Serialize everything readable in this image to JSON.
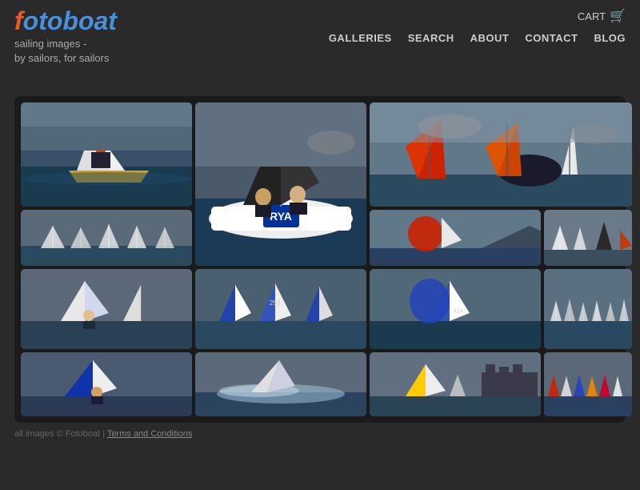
{
  "header": {
    "cart_label": "CART",
    "logo_f": "f",
    "logo_rest": "otoboat",
    "tagline_line1": "sailing images -",
    "tagline_line2": "by sailors, for sailors"
  },
  "nav": {
    "items": [
      {
        "label": "GALLERIES",
        "id": "nav-galleries"
      },
      {
        "label": "SEARCH",
        "id": "nav-search"
      },
      {
        "label": "ABOUT",
        "id": "nav-about"
      },
      {
        "label": "CONTACT",
        "id": "nav-contact"
      },
      {
        "label": "BLOG",
        "id": "nav-blog"
      }
    ]
  },
  "footer": {
    "copyright": "all images © Fotoboat  |  ",
    "terms_label": "Terms and Conditions"
  },
  "gallery": {
    "images": [
      {
        "id": "img1",
        "alt": "Sailor hiking out on dinghy",
        "type": "big-1"
      },
      {
        "id": "img2",
        "alt": "Two sailors on RYA boat",
        "type": "big-2"
      },
      {
        "id": "img3",
        "alt": "Windsurfers with colourful sails",
        "type": "big-3"
      },
      {
        "id": "img4",
        "alt": "Small dinghy fleet racing",
        "type": "r2c1"
      },
      {
        "id": "img5",
        "alt": "Dinghy with red spinnaker",
        "type": "r2c3"
      },
      {
        "id": "img6",
        "alt": "Rock with sailing boats",
        "type": "r2c4"
      },
      {
        "id": "img7",
        "alt": "Racing dinghies",
        "type": "r3c1"
      },
      {
        "id": "img8",
        "alt": "Blue and white sail fleet",
        "type": "r3c2"
      },
      {
        "id": "img9",
        "alt": "Dinghy sailing action",
        "type": "r3c3"
      },
      {
        "id": "img10",
        "alt": "Large fleet racing",
        "type": "r3c4"
      },
      {
        "id": "img11",
        "alt": "Blue dinghy",
        "type": "r4c1"
      },
      {
        "id": "img12",
        "alt": "Wave action dinghy",
        "type": "r4c2"
      },
      {
        "id": "img13",
        "alt": "Yellow boat racing",
        "type": "r4c3"
      },
      {
        "id": "img14",
        "alt": "Castle harbour racing",
        "type": "r4c4"
      }
    ]
  }
}
